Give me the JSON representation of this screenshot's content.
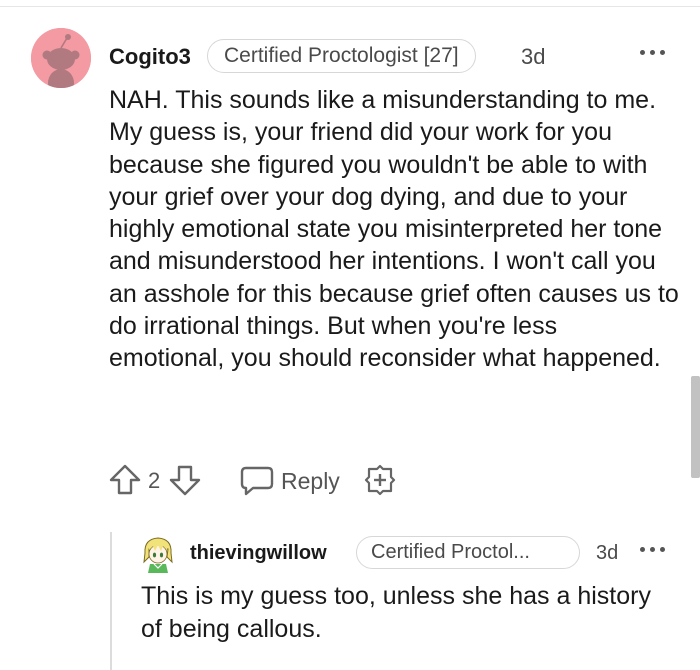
{
  "comment": {
    "username": "Cogito3",
    "flair": "Certified Proctologist [27]",
    "age": "3d",
    "body": "NAH. This sounds like a misunderstanding to me. My guess is, your friend did your work for you because she figured you wouldn't be able to with your grief over your dog dying, and due to your highly emotional state you misinterpreted her tone and misunderstood her intentions. I won't call you an asshole for this because grief often causes us to do irrational things. But when you're less emotional, you should reconsider what happened.",
    "votes": "2",
    "reply_label": "Reply",
    "avatar_color": "#f39aa2",
    "icons": [
      "upvote-icon",
      "downvote-icon",
      "reply-icon",
      "award-icon",
      "more-options-icon"
    ]
  },
  "reply": {
    "username": "thievingwillow",
    "flair": "Certified Proctol...",
    "age": "3d",
    "body": "This is my guess too, unless she has a history of being callous."
  },
  "colors": {
    "text": "#1a1a1b",
    "muted": "#4a4a4a",
    "border": "#d7d7d7"
  }
}
